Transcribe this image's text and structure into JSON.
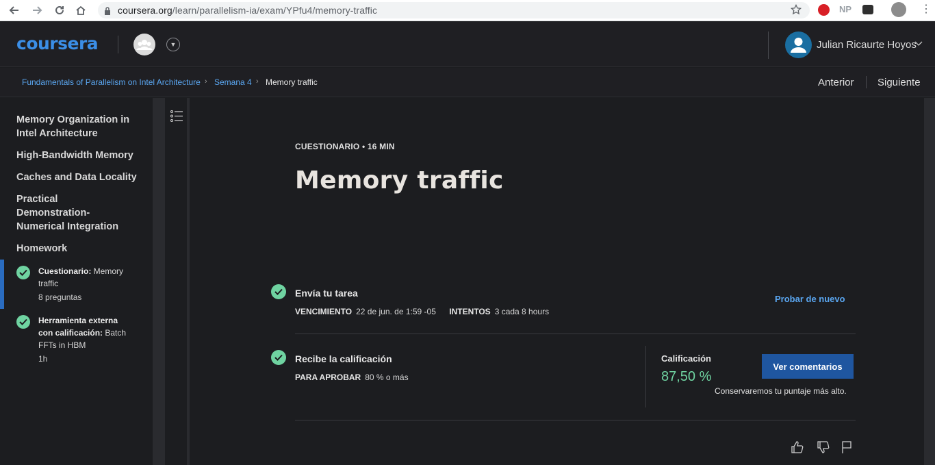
{
  "browser": {
    "url_domain": "coursera.org",
    "url_path": "/learn/parallelism-ia/exam/YPfu4/memory-traffic",
    "ext_np": "NP"
  },
  "header": {
    "logo": "coursera",
    "user_name": "Julian Ricaurte Hoyos"
  },
  "breadcrumb": {
    "course": "Fundamentals of Parallelism on Intel Architecture",
    "week": "Semana 4",
    "current": "Memory traffic",
    "prev": "Anterior",
    "next": "Siguiente"
  },
  "sidebar": {
    "headings": [
      "Memory Organization in Intel Architecture",
      "High-Bandwidth Memory",
      "Caches and Data Locality",
      "Practical Demonstration-Numerical Integration",
      "Homework"
    ],
    "items": [
      {
        "kind": "Cuestionario:",
        "name": " Memory traffic",
        "meta": "8 preguntas",
        "active": true,
        "completed": true
      },
      {
        "kind": "Herramienta externa con calificación:",
        "name": " Batch FFTs in HBM",
        "meta": "1h",
        "active": false,
        "completed": true
      }
    ]
  },
  "main": {
    "eyebrow": "CUESTIONARIO • 16 MIN",
    "title": "Memory traffic",
    "submit": {
      "title": "Envía tu tarea",
      "due_label": "VENCIMIENTO",
      "due_value": "22 de jun. de 1:59 -05",
      "attempts_label": "INTENTOS",
      "attempts_value": "3 cada 8 hours",
      "retry": "Probar de nuevo"
    },
    "grade": {
      "title": "Recibe la calificación",
      "pass_label": "PARA APROBAR",
      "pass_value": "80 % o más",
      "grade_label": "Calificación",
      "grade_value": "87,50 %",
      "note": "Conservaremos tu puntaje más alto.",
      "button": "Ver comentarios"
    }
  },
  "colors": {
    "accent": "#3b8ee6",
    "link": "#5aa6f0",
    "success": "#6fd3a1",
    "button": "#1f56a0",
    "background": "#1c1d20"
  }
}
